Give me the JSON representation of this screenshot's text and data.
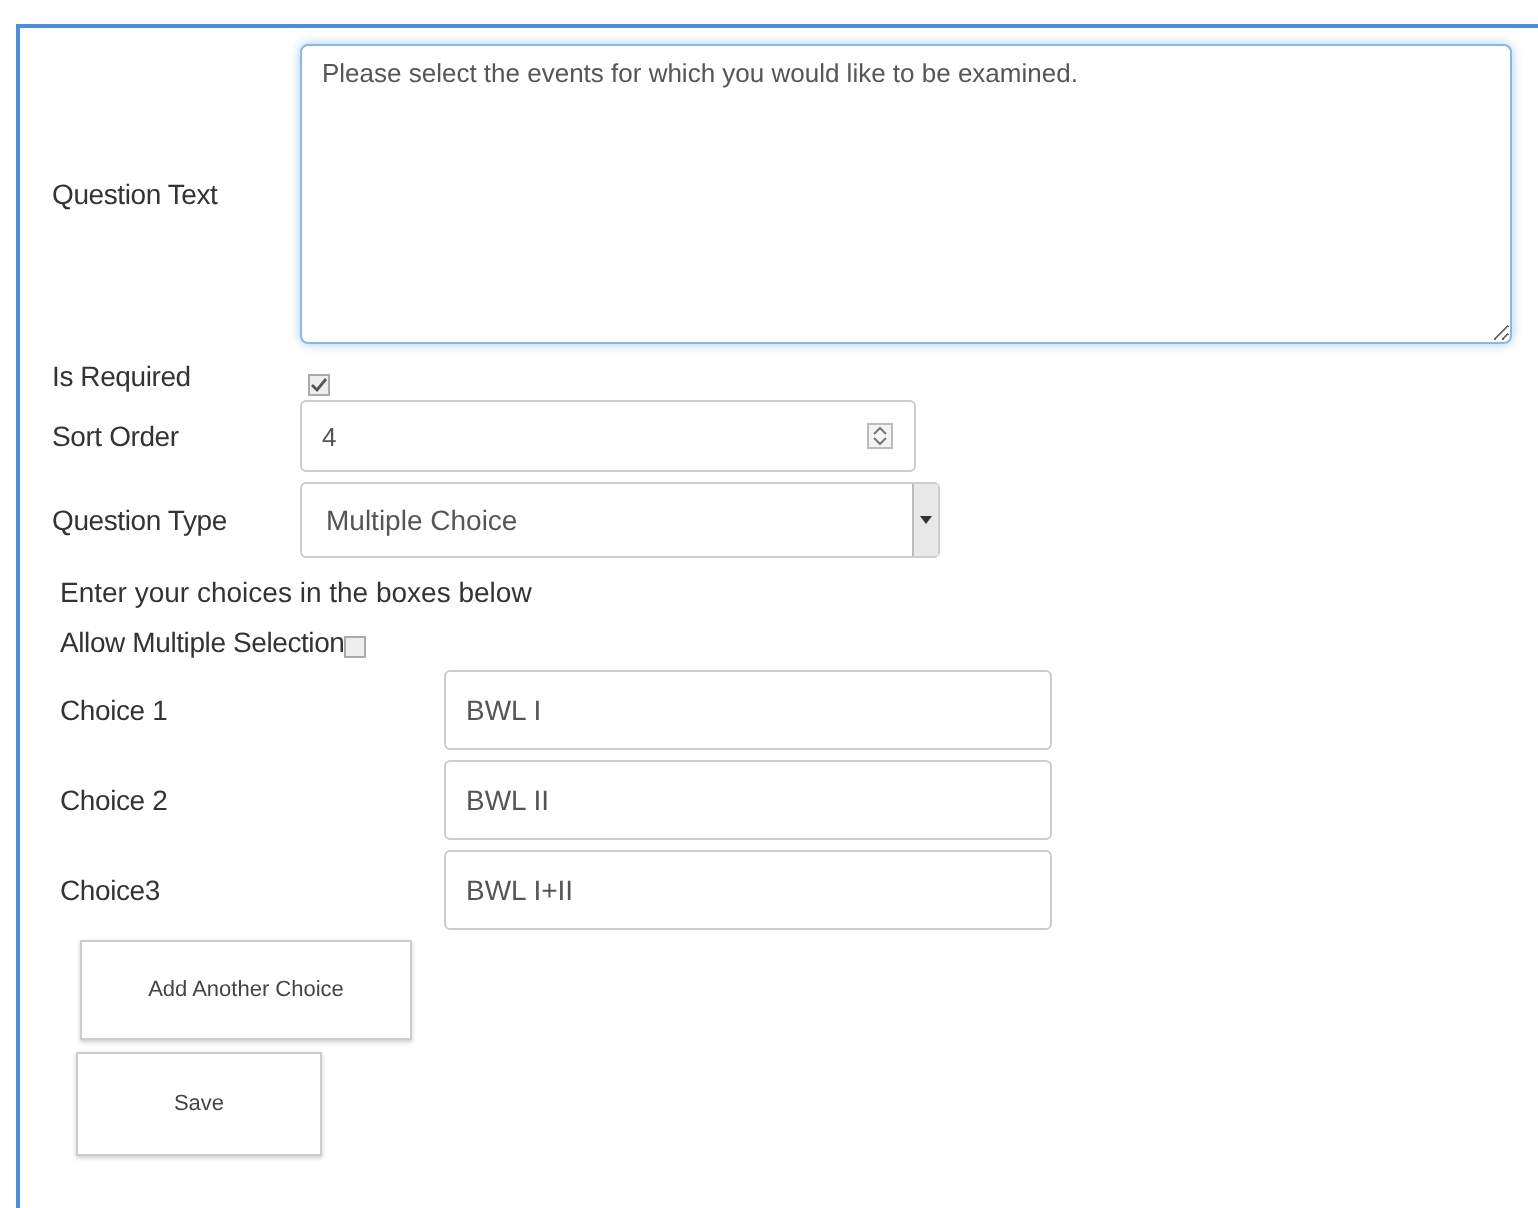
{
  "question_text": {
    "label": "Question Text",
    "value": "Please select the events for which you would like to be examined."
  },
  "is_required": {
    "label": "Is Required",
    "checked": true
  },
  "sort_order": {
    "label": "Sort Order",
    "value": "4"
  },
  "question_type": {
    "label": "Question Type",
    "value": "Multiple Choice"
  },
  "choices_hint": "Enter your choices in the boxes below",
  "allow_multiple": {
    "label": "Allow Multiple Selection",
    "checked": false
  },
  "choices": [
    {
      "label": "Choice 1",
      "value": "BWL I"
    },
    {
      "label": "Choice 2",
      "value": "BWL II"
    },
    {
      "label": "Choice3",
      "value": "BWL I+II"
    }
  ],
  "buttons": [
    {
      "kind": "add",
      "label": "Add Another Choice"
    },
    {
      "kind": "save",
      "label": "Save"
    }
  ]
}
